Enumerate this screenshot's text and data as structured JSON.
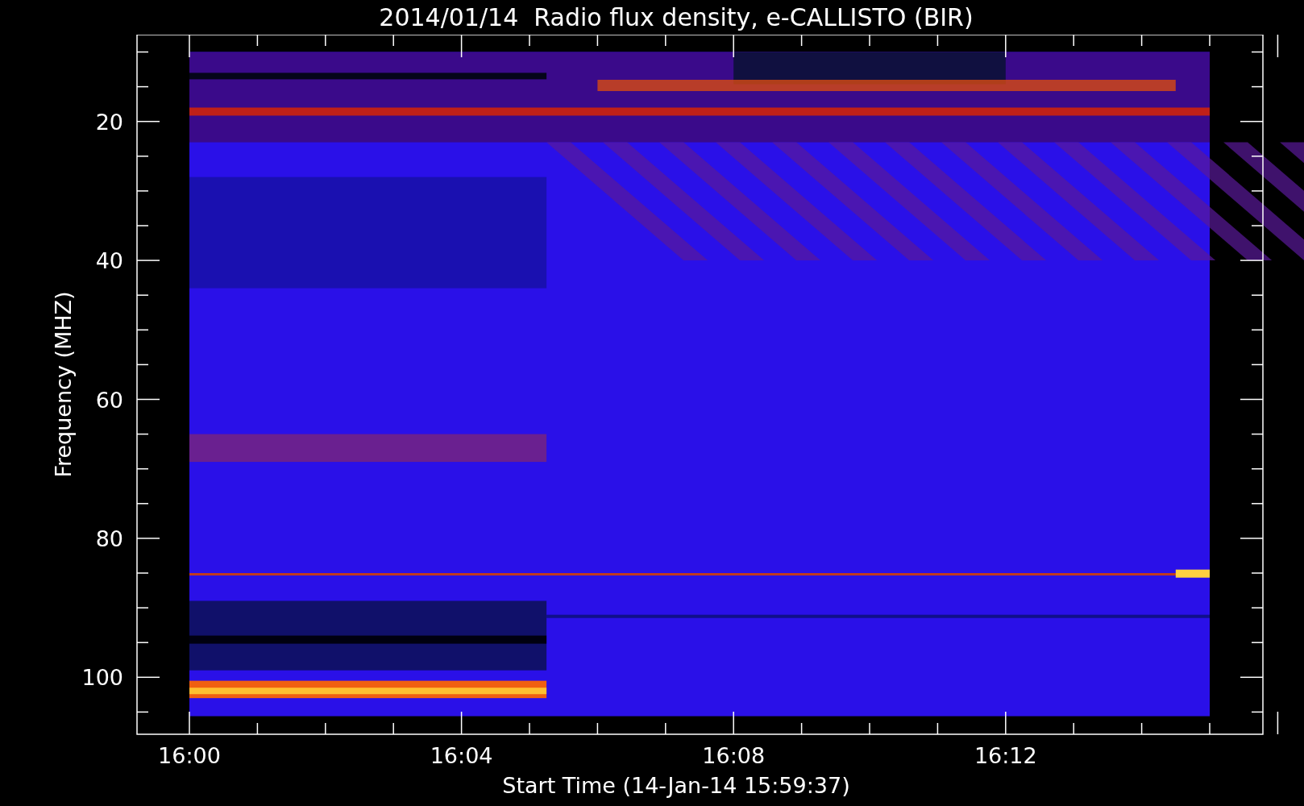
{
  "title": "2014/01/14  Radio flux density, e-CALLISTO (BIR)",
  "y_axis": {
    "label": "Frequency (MHZ)",
    "ticks": [
      "20",
      "40",
      "60",
      "80",
      "100"
    ]
  },
  "x_axis": {
    "label": "Start Time (14-Jan-14 15:59:37)",
    "ticks": [
      "16:00",
      "16:04",
      "16:08",
      "16:12"
    ]
  }
}
